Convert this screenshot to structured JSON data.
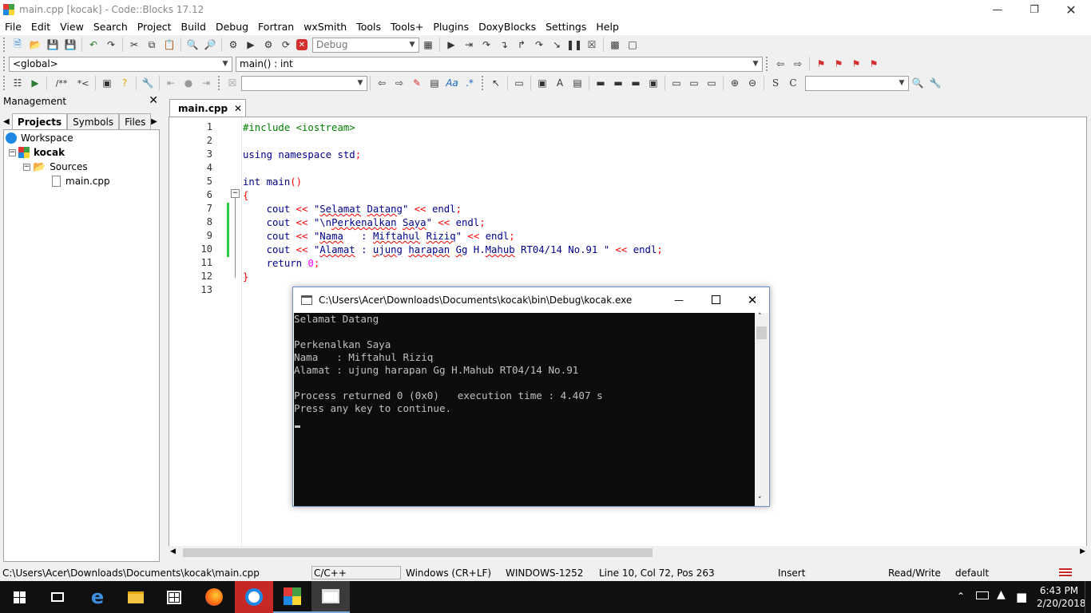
{
  "window": {
    "title": "main.cpp [kocak] - Code::Blocks 17.12"
  },
  "menu": [
    "File",
    "Edit",
    "View",
    "Search",
    "Project",
    "Build",
    "Debug",
    "Fortran",
    "wxSmith",
    "Tools",
    "Tools+",
    "Plugins",
    "DoxyBlocks",
    "Settings",
    "Help"
  ],
  "toolbar": {
    "build_target": "Debug",
    "scope": "<global>",
    "function": "main() : int",
    "doxy_line_comment": "/**",
    "doxy_block_comment": "*<",
    "search_value": "",
    "find_value": ""
  },
  "management": {
    "title": "Management",
    "tabs": [
      "Projects",
      "Symbols",
      "Files"
    ],
    "tree": {
      "workspace": "Workspace",
      "project": "kocak",
      "folder": "Sources",
      "file": "main.cpp"
    }
  },
  "editor": {
    "tab": "main.cpp",
    "line_numbers": [
      "1",
      "2",
      "3",
      "4",
      "5",
      "6",
      "7",
      "8",
      "9",
      "10",
      "11",
      "12",
      "13"
    ]
  },
  "console": {
    "title": "C:\\Users\\Acer\\Downloads\\Documents\\kocak\\bin\\Debug\\kocak.exe",
    "lines": [
      "Selamat Datang",
      "",
      "Perkenalkan Saya",
      "Nama   : Miftahul Riziq",
      "Alamat : ujung harapan Gg H.Mahub RT04/14 No.91",
      "",
      "Process returned 0 (0x0)   execution time : 4.407 s",
      "Press any key to continue."
    ]
  },
  "status": {
    "path": "C:\\Users\\Acer\\Downloads\\Documents\\kocak\\main.cpp",
    "lang": "C/C++",
    "eol": "Windows (CR+LF)",
    "encoding": "WINDOWS-1252",
    "position": "Line 10, Col 72, Pos 263",
    "mode": "Insert",
    "access": "Read/Write",
    "profile": "default"
  },
  "tray": {
    "time": "6:43 PM",
    "date": "2/20/2018"
  },
  "colors": {
    "taskbar": "#101010",
    "active_app": "#c62828",
    "console_bg": "#0c0c0c",
    "changed_line_marker": "#2ecc40"
  }
}
